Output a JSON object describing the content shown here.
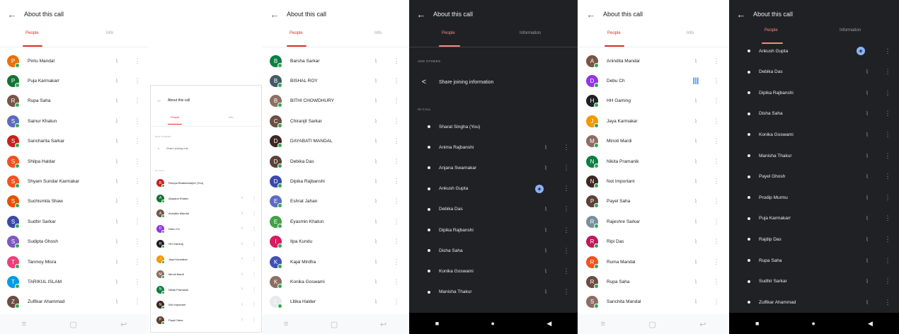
{
  "p1": {
    "title": "About this call",
    "tab_people": "People",
    "tab_info": "Info",
    "participants": [
      {
        "name": "Pintu Mandal",
        "initial": "P",
        "color": "#e8710a"
      },
      {
        "name": "Puja Karmakarr",
        "initial": "P",
        "color": "#137333"
      },
      {
        "name": "Rupa Saha",
        "initial": "R",
        "color": "#795548"
      },
      {
        "name": "Sainur Khatun",
        "initial": "S",
        "color": "#5c6bc0"
      },
      {
        "name": "Sancharita Sarkar",
        "initial": "S",
        "color": "#c5221f"
      },
      {
        "name": "Shilpa Haldar",
        "initial": "S",
        "color": "#f4511e"
      },
      {
        "name": "Shyam Sundar Karmakar",
        "initial": "S",
        "color": "#f4511e"
      },
      {
        "name": "Suchismita Shaw",
        "initial": "S",
        "color": "#e65100"
      },
      {
        "name": "Sudhir Sarkar",
        "initial": "S",
        "color": "#3949ab"
      },
      {
        "name": "Sudipta Ghosh",
        "initial": "S",
        "color": "#7e57c2"
      },
      {
        "name": "Tanmoy Misra",
        "initial": "T",
        "color": "#ec407a"
      },
      {
        "name": "TARIKUL ISLAM",
        "initial": "T",
        "color": "#039be5"
      },
      {
        "name": "Zulfikar Ahammad",
        "initial": "Z",
        "color": "#6d4c41"
      }
    ],
    "nav": [
      "≡",
      "▢",
      "↩"
    ]
  },
  "p2": {
    "title": "About this call",
    "tab_people": "People",
    "tab_info": "Info",
    "add_others": "ADD OTHERS",
    "share": "Share joining info",
    "in_call": "IN CALL",
    "participants": [
      {
        "name": "Rumpa Bhattacharjee (You)",
        "initial": "R",
        "color": "#c5221f"
      },
      {
        "name": "Alapana Khatun",
        "initial": "A",
        "color": "#137333"
      },
      {
        "name": "Anindita Mandal",
        "initial": "A",
        "color": "#795548"
      },
      {
        "name": "Debu Ch",
        "initial": "D",
        "color": "#9334e6"
      },
      {
        "name": "HH Gaming",
        "initial": "H",
        "color": "#202124"
      },
      {
        "name": "Jaya Karmakar",
        "initial": "J",
        "color": "#f29900"
      },
      {
        "name": "Minoti Mardi",
        "initial": "M",
        "color": "#8d6e63"
      },
      {
        "name": "Nikita Pramanik",
        "initial": "N",
        "color": "#0b8043"
      },
      {
        "name": "Not Important",
        "initial": "N",
        "color": "#3e2723"
      },
      {
        "name": "Payel Saha",
        "initial": "P",
        "color": "#5d4037"
      }
    ]
  },
  "p3": {
    "title": "About this call",
    "tab_people": "People",
    "tab_info": "Info",
    "participants": [
      {
        "name": "Barsha Sarkar",
        "initial": "B",
        "color": "#0b8043"
      },
      {
        "name": "BISHAL ROY",
        "initial": "B",
        "color": "#455a64"
      },
      {
        "name": "BITHI CHOWDHURY",
        "initial": "B",
        "color": "#8d6e63"
      },
      {
        "name": "Chiranjit Sarkar",
        "initial": "C",
        "color": "#6d4c41"
      },
      {
        "name": "DAYABATI MANDAL",
        "initial": "D",
        "color": "#3e2723"
      },
      {
        "name": "Debika Das",
        "initial": "D",
        "color": "#5d4037"
      },
      {
        "name": "Dipika Rajbanshi",
        "initial": "D",
        "color": "#3949ab"
      },
      {
        "name": "Eshrat Jahan",
        "initial": "E",
        "color": "#5c6bc0"
      },
      {
        "name": "Eyasmin Khatun",
        "initial": "E",
        "color": "#43a047"
      },
      {
        "name": "Ilpa Kundu",
        "initial": "I",
        "color": "#d81b60"
      },
      {
        "name": "Kajal Mirdha",
        "initial": "K",
        "color": "#3f51b5"
      },
      {
        "name": "Konika Goswami",
        "initial": "K",
        "color": "#8d6e63"
      },
      {
        "name": "Litika Halder",
        "initial": "L",
        "color": "#e8eaed"
      }
    ],
    "nav": [
      "≡",
      "▢",
      "↩"
    ]
  },
  "p4": {
    "title": "About this call",
    "tab_people": "People",
    "tab_info": "Information",
    "add_others": "ADD OTHERS",
    "share": "Share joining information",
    "in_call": "IN CALL",
    "participants": [
      {
        "name": "Sharat Singha (You)",
        "mic": false
      },
      {
        "name": "Anima Rajbanshi",
        "mic": true
      },
      {
        "name": "Anjana Swarnakar",
        "mic": true
      },
      {
        "name": "Ankush Gupta",
        "mic": "speaking"
      },
      {
        "name": "Debika Das",
        "mic": true
      },
      {
        "name": "Dipika Rajbanshi",
        "mic": true
      },
      {
        "name": "Disha Saha",
        "mic": true
      },
      {
        "name": "Konika Goswami",
        "mic": true
      },
      {
        "name": "Manisha Thakur",
        "mic": true
      }
    ],
    "nav": [
      "■",
      "●",
      "◀"
    ]
  },
  "p5": {
    "title": "About this call",
    "tab_people": "People",
    "tab_info": "Info",
    "participants": [
      {
        "name": "Anindita Mandal",
        "initial": "A",
        "color": "#795548"
      },
      {
        "name": "Debu Ch",
        "initial": "D",
        "color": "#9334e6"
      },
      {
        "name": "HH Gaming",
        "initial": "H",
        "color": "#202124"
      },
      {
        "name": "Jaya Karmakar",
        "initial": "J",
        "color": "#f29900"
      },
      {
        "name": "Minoti Mardi",
        "initial": "M",
        "color": "#8d6e63"
      },
      {
        "name": "Nikita Pramanik",
        "initial": "N",
        "color": "#0b8043"
      },
      {
        "name": "Not Important",
        "initial": "N",
        "color": "#3e2723"
      },
      {
        "name": "Payel Saha",
        "initial": "P",
        "color": "#5d4037"
      },
      {
        "name": "Rajeshre Sarkar",
        "initial": "R",
        "color": "#78909c"
      },
      {
        "name": "Ripi Das",
        "initial": "R",
        "color": "#c2185b"
      },
      {
        "name": "Ruma Mandal",
        "initial": "R",
        "color": "#f4511e"
      },
      {
        "name": "Rupa Saha",
        "initial": "R",
        "color": "#6d4c41"
      },
      {
        "name": "Sanchita Mandal",
        "initial": "S",
        "color": "#8d6e63"
      }
    ],
    "nav": [
      "≡",
      "▢",
      "↩"
    ]
  },
  "p6": {
    "title": "About this call",
    "tab_people": "People",
    "tab_info": "Information",
    "participants": [
      {
        "name": "Ankush Gupta",
        "mic": "speaking"
      },
      {
        "name": "Debika Das",
        "mic": true
      },
      {
        "name": "Dipika Rajbanshi",
        "mic": true
      },
      {
        "name": "Disha Saha",
        "mic": true
      },
      {
        "name": "Konika Goswami",
        "mic": true
      },
      {
        "name": "Manisha Thakur",
        "mic": true
      },
      {
        "name": "Payel Ghosh",
        "mic": true
      },
      {
        "name": "Prodip Murmu",
        "mic": true
      },
      {
        "name": "Puja Karmakarr",
        "mic": true
      },
      {
        "name": "Rajdip Das",
        "mic": true
      },
      {
        "name": "Rupa Saha",
        "mic": true
      },
      {
        "name": "Sudhir Sarkar",
        "mic": true
      },
      {
        "name": "Zulfikar Ahammad",
        "mic": true
      }
    ],
    "nav": [
      "■",
      "●",
      "◀"
    ]
  },
  "icons": {
    "back": "←",
    "mic_off": "🎙",
    "more": "⋮",
    "share": "<",
    "speaking": "◈",
    "bars": "|||"
  }
}
